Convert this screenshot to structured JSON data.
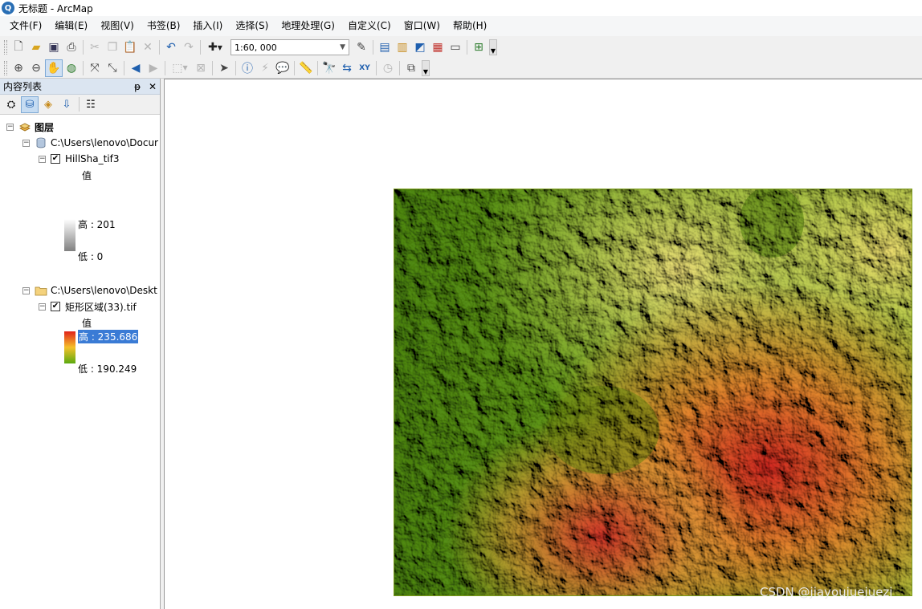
{
  "window": {
    "title": "无标题 - ArcMap",
    "app_icon": "arcmap-globe-icon"
  },
  "menubar": {
    "items": [
      "文件(F)",
      "编辑(E)",
      "视图(V)",
      "书签(B)",
      "插入(I)",
      "选择(S)",
      "地理处理(G)",
      "自定义(C)",
      "窗口(W)",
      "帮助(H)"
    ]
  },
  "standard_toolbar": {
    "scale": "1:60, 000",
    "icons": [
      "new-document-icon",
      "open-folder-icon",
      "save-icon",
      "print-icon",
      "cut-icon",
      "copy-icon",
      "paste-icon",
      "delete-icon",
      "undo-icon",
      "redo-icon",
      "add-data-icon",
      "editor-toolbar-icon",
      "table-of-contents-icon",
      "catalog-window-icon",
      "search-window-icon",
      "arctoolbox-icon",
      "python-window-icon",
      "model-builder-icon"
    ]
  },
  "tools_toolbar": {
    "icons": [
      "zoom-in-icon",
      "zoom-out-icon",
      "pan-icon",
      "full-extent-icon",
      "fixed-zoom-in-icon",
      "fixed-zoom-out-icon",
      "back-extent-icon",
      "forward-extent-icon",
      "select-features-icon",
      "clear-selection-icon",
      "select-elements-icon",
      "identify-icon",
      "hyperlink-icon",
      "html-popup-icon",
      "measure-icon",
      "find-icon",
      "find-route-icon",
      "go-to-xy-icon",
      "time-slider-icon",
      "create-viewer-window-icon"
    ]
  },
  "toc": {
    "title": "内容列表",
    "pin": "ᵽ",
    "close": "✕",
    "root_label": "图层",
    "group1": {
      "path": "C:\\Users\\lenovo\\Docur",
      "layer": {
        "name": "HillSha_tif3",
        "checked": true,
        "value_label": "值",
        "high_label": "高 : 201",
        "low_label": "低 : 0",
        "ramp": [
          "#ffffff",
          "#808080"
        ]
      }
    },
    "group2": {
      "path": "C:\\Users\\lenovo\\Deskt",
      "layer": {
        "name": "矩形区域(33).tif",
        "checked": true,
        "value_label": "值",
        "high_label": "高 : 235.686",
        "low_label": "低 : 190.249",
        "ramp": [
          "#e0221a",
          "#f5c12a",
          "#5aaa10"
        ]
      }
    }
  },
  "map": {
    "watermark": "CSDN @jiayoujuejuezi"
  }
}
